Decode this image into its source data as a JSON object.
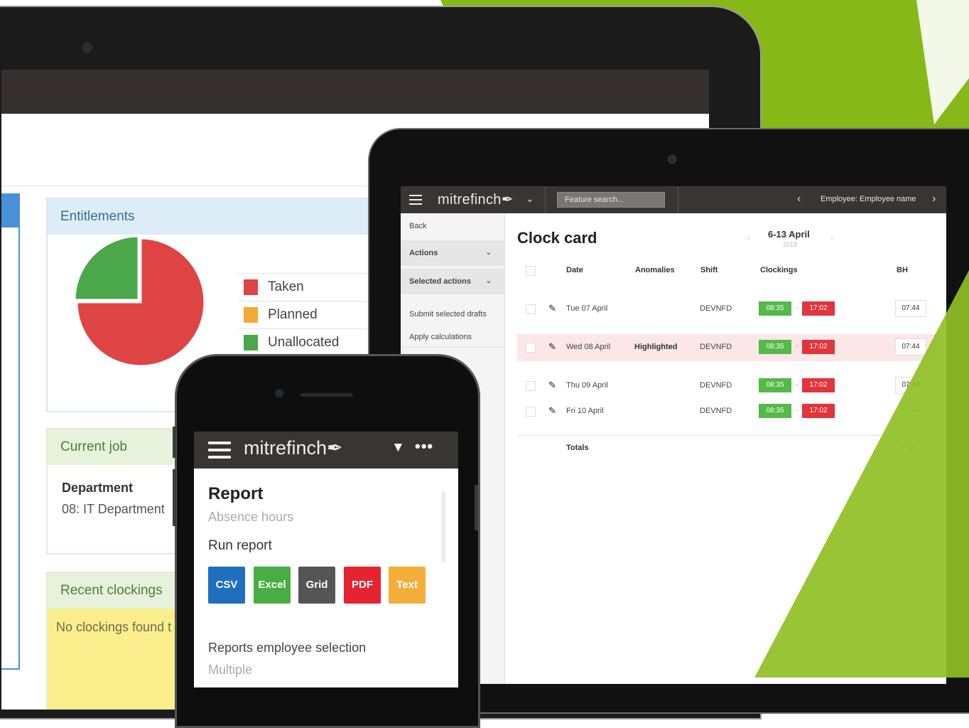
{
  "colors": {
    "brand_green": "#86b817",
    "taken": "#df4444",
    "planned": "#f5a833",
    "unallocated": "#4aa84a",
    "clock_in": "#54b948",
    "clock_out": "#e3343b",
    "csv": "#1f6fbf",
    "excel": "#49ad43",
    "grid": "#555555",
    "pdf": "#e62431",
    "text": "#f5ad3a"
  },
  "desktop": {
    "entitlements": {
      "title": "Entitlements",
      "legend": [
        "Taken",
        "Planned",
        "Unallocated"
      ],
      "pie": {
        "taken": 0.75,
        "unallocated": 0.25
      }
    },
    "current_job": {
      "title": "Current job",
      "label": "Department",
      "value": "08: IT Department"
    },
    "recent_clockings": {
      "title": "Recent clockings",
      "empty": "No clockings found t"
    }
  },
  "tablet": {
    "logo": "mitrefinch",
    "search_placeholder": "Feature search...",
    "employee": "Employee: Employee name",
    "sidebar": {
      "back": "Back",
      "actions": "Actions",
      "selected_actions": "Selected actions",
      "submit": "Submit selected drafts",
      "apply": "Apply calculations"
    },
    "title": "Clock card",
    "range": "6-13 April",
    "year": "2018",
    "headers": {
      "date": "Date",
      "anomalies": "Anomalies",
      "shift": "Shift",
      "clockings": "Clockings",
      "bh": "BH"
    },
    "rows": [
      {
        "date": "Tue 07 April",
        "anomaly": "",
        "shift": "DEVNFD",
        "in": "08:35",
        "out": "17:02",
        "bh": "07:44"
      },
      {
        "date": "Wed 08 April",
        "anomaly": "Highlighted",
        "shift": "DEVNFD",
        "in": "08:35",
        "out": "17:02",
        "bh": "07:44"
      },
      {
        "date": "Thu 09 April",
        "anomaly": "",
        "shift": "DEVNFD",
        "in": "08:35",
        "out": "17:02",
        "bh": "07:44"
      },
      {
        "date": "Fri 10 April",
        "anomaly": "",
        "shift": "DEVNFD",
        "in": "08:35",
        "out": "17:02",
        "bh": "07:44"
      }
    ],
    "dash": "-",
    "totals_label": "Totals",
    "totals_value": "37:50"
  },
  "phone": {
    "logo": "mitrefinch",
    "title": "Report",
    "subtitle": "Absence hours",
    "run_report": "Run report",
    "buttons": {
      "csv": "CSV",
      "excel": "Excel",
      "grid": "Grid",
      "pdf": "PDF",
      "text": "Text"
    },
    "selection_label": "Reports employee selection",
    "selection_value": "Multiple"
  },
  "icons": {
    "menu": "hamburger-icon",
    "caret": "chevron-down-icon",
    "more": "more-dots-icon",
    "edit": "pencil-icon",
    "prev": "chevron-left-icon",
    "next": "chevron-right-icon",
    "logo_mark": "quill-icon"
  }
}
